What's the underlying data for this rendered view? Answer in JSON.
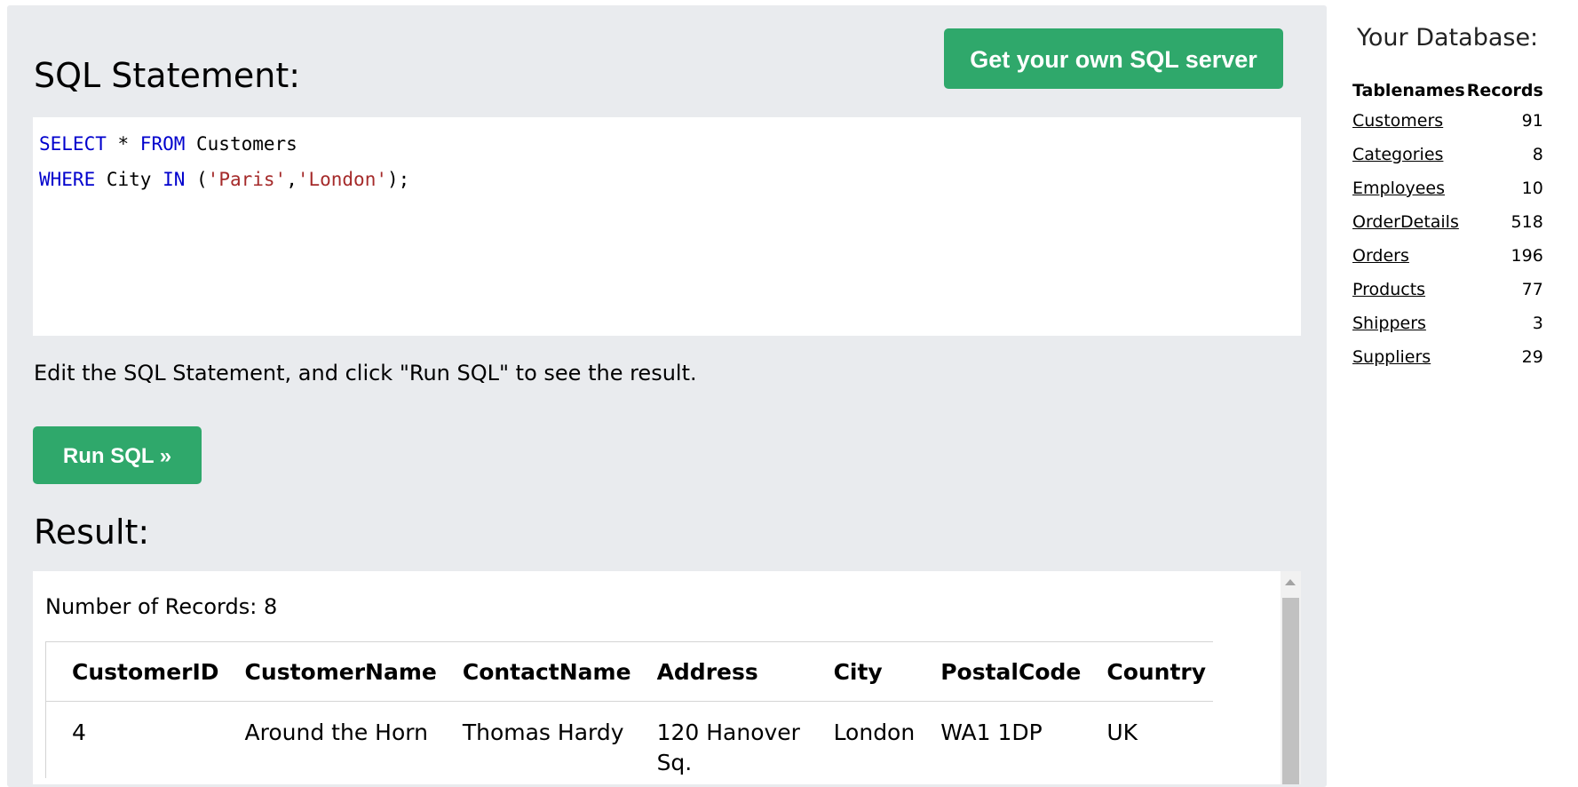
{
  "header": {
    "sql_statement_heading": "SQL Statement:",
    "get_server_label": "Get your own SQL server"
  },
  "editor": {
    "line1": {
      "kw1": "SELECT",
      "t1": " * ",
      "kw2": "FROM",
      "t2": " Customers"
    },
    "line2": {
      "kw1": "WHERE",
      "t1": " City ",
      "kw2": "IN",
      "t2": " (",
      "s1": "'Paris'",
      "t3": ",",
      "s2": "'London'",
      "t4": ");"
    }
  },
  "instructions": "Edit the SQL Statement, and click \"Run SQL\" to see the result.",
  "run_sql_label": "Run SQL »",
  "result": {
    "heading": "Result:",
    "record_count": "Number of Records: 8",
    "columns": [
      "CustomerID",
      "CustomerName",
      "ContactName",
      "Address",
      "City",
      "PostalCode",
      "Country"
    ],
    "rows": [
      {
        "CustomerID": "4",
        "CustomerName": "Around the Horn",
        "ContactName": "Thomas Hardy",
        "Address": "120 Hanover Sq.",
        "City": "London",
        "PostalCode": "WA1 1DP",
        "Country": "UK"
      }
    ]
  },
  "sidebar": {
    "title": "Your Database:",
    "col_tablenames": "Tablenames",
    "col_records": "Records",
    "tables": [
      {
        "name": "Customers",
        "records": "91"
      },
      {
        "name": "Categories",
        "records": "8"
      },
      {
        "name": "Employees",
        "records": "10"
      },
      {
        "name": "OrderDetails",
        "records": "518"
      },
      {
        "name": "Orders",
        "records": "196"
      },
      {
        "name": "Products",
        "records": "77"
      },
      {
        "name": "Shippers",
        "records": "3"
      },
      {
        "name": "Suppliers",
        "records": "29"
      }
    ]
  },
  "colors": {
    "accent_green": "#2fa86b",
    "panel_bg": "#e9ebee",
    "keyword": "#0000cd",
    "string": "#a52a2a"
  }
}
